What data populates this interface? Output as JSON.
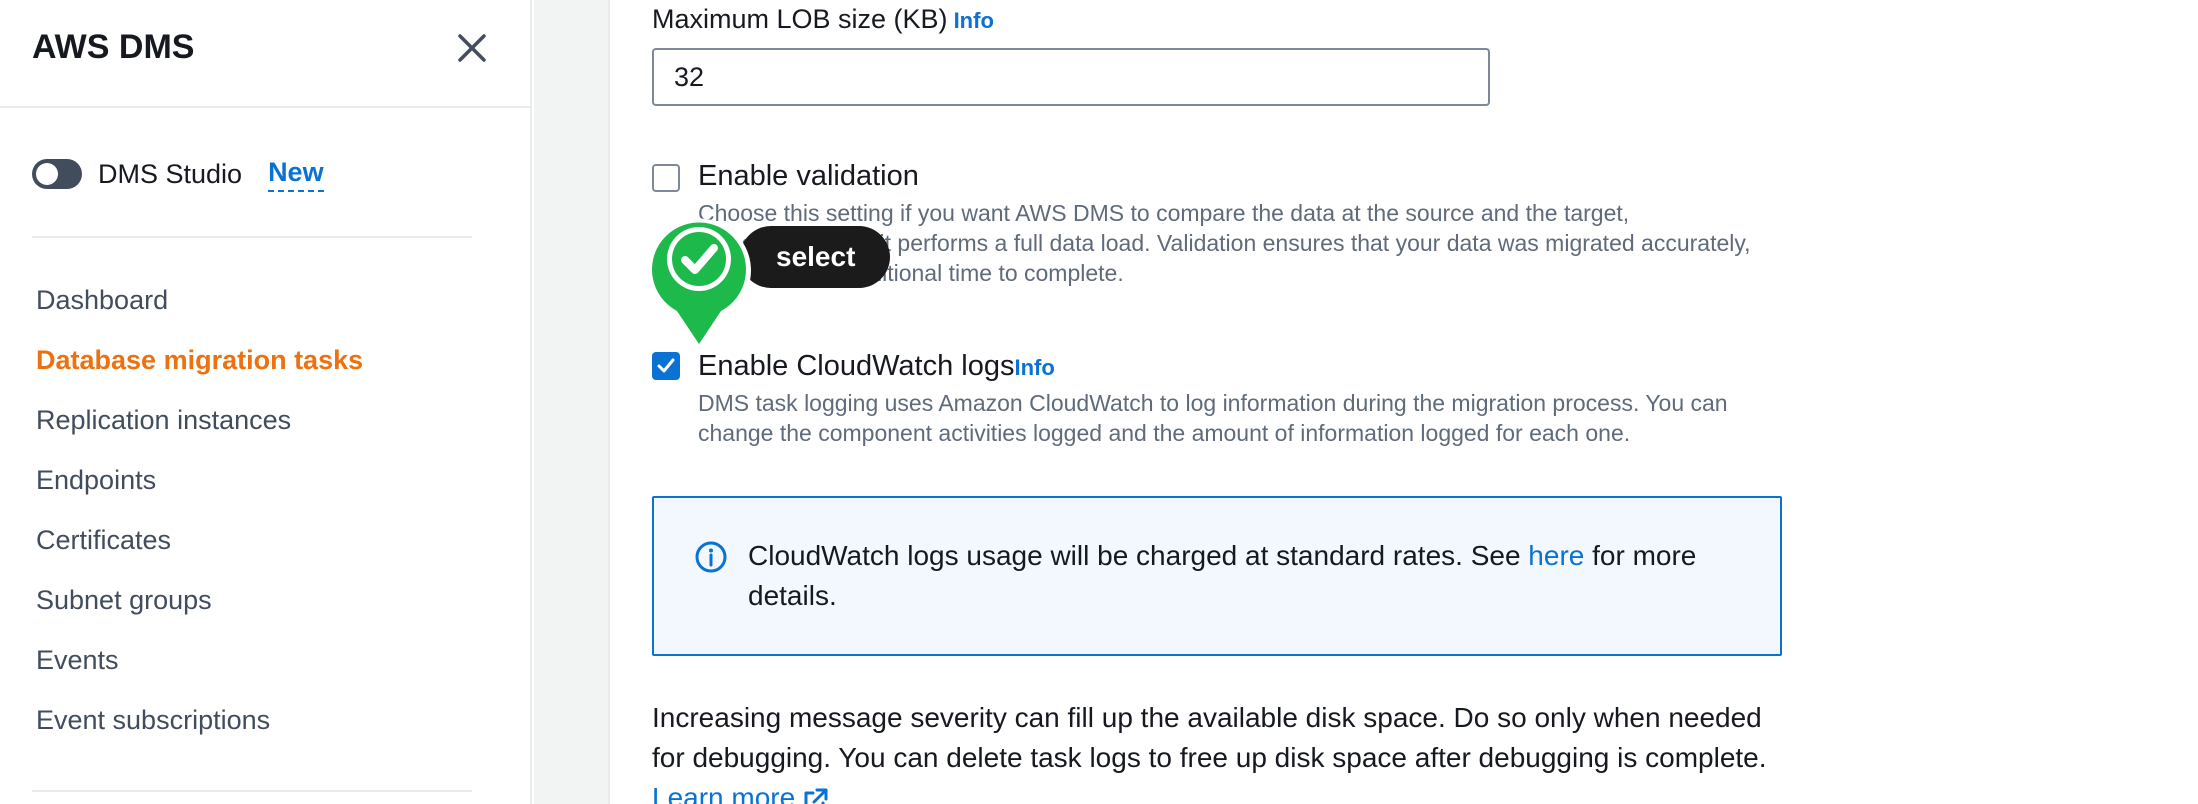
{
  "sidebar": {
    "title": "AWS DMS",
    "studio_label": "DMS Studio",
    "studio_badge": "New",
    "items": [
      {
        "label": "Dashboard"
      },
      {
        "label": "Database migration tasks",
        "active": true
      },
      {
        "label": "Replication instances"
      },
      {
        "label": "Endpoints"
      },
      {
        "label": "Certificates"
      },
      {
        "label": "Subnet groups"
      },
      {
        "label": "Events"
      },
      {
        "label": "Event subscriptions"
      }
    ]
  },
  "main": {
    "lob_label": "Maximum LOB size (KB)",
    "lob_info": "Info",
    "lob_value": "32",
    "validation": {
      "label": "Enable validation",
      "checked": false,
      "description": "Choose this setting if you want AWS DMS to compare the data at the source and the target, immediately after it performs a full data load. Validation ensures that your data was migrated accurately, but it requires additional time to complete."
    },
    "cloudwatch": {
      "label": "Enable CloudWatch logs",
      "info": "Info",
      "checked": true,
      "description": "DMS task logging uses Amazon CloudWatch to log information during the migration process. You can change the component activities logged and the amount of information logged for each one."
    },
    "alert": {
      "text_before": "CloudWatch logs usage will be charged at standard rates. See",
      "link": "here",
      "text_after": "for more details."
    },
    "warning": {
      "text": "Increasing message severity can fill up the available disk space. Do so only when needed for debugging. You can delete task logs to free up disk space after debugging is complete.",
      "link": "Learn more"
    }
  },
  "overlay": {
    "action_label": "select",
    "marker_color": "#1db94a"
  },
  "colors": {
    "accent": "#0972d3",
    "active_nav": "#ec7211"
  }
}
